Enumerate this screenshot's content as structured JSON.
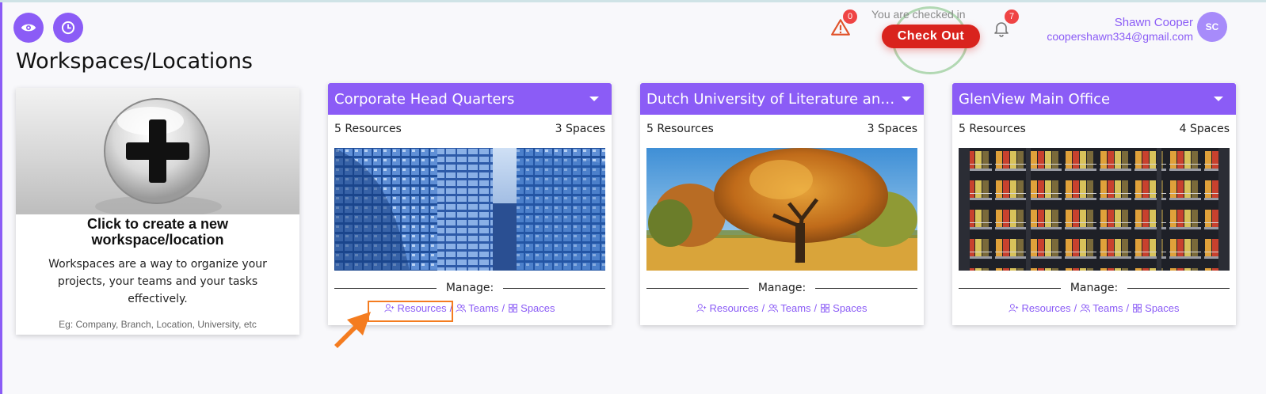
{
  "header": {
    "alerts_count": "0",
    "checked_in_text": "You are checked in",
    "checkout_label": "Check Out",
    "notifications_count": "7",
    "user_name": "Shawn Cooper",
    "user_email": "coopershawn334@gmail.com",
    "avatar_initials": "SC"
  },
  "page": {
    "title": "Workspaces/Locations"
  },
  "create_card": {
    "title": "Click to create a new workspace/location",
    "description": "Workspaces are a way to organize your projects, your teams and your tasks effectively.",
    "example": "Eg: Company, Branch, Location, University, etc"
  },
  "workspaces": [
    {
      "name": "Corporate Head Quarters",
      "resources": "5 Resources",
      "spaces": "3 Spaces"
    },
    {
      "name": "Dutch University of Literature and Arts",
      "resources": "5 Resources",
      "spaces": "3 Spaces"
    },
    {
      "name": "GlenView Main Office",
      "resources": "5 Resources",
      "spaces": "4 Spaces"
    }
  ],
  "manage": {
    "label": "Manage:",
    "resources_link": "Resources",
    "teams_link": "Teams",
    "spaces_link": "Spaces",
    "separator": "/"
  },
  "colors": {
    "accent": "#8b5cf6",
    "checkout": "#d9231d",
    "badge": "#ef4444",
    "highlight": "#f47c20"
  },
  "icons": {
    "left_buttons": [
      "eye-icon",
      "clock-icon"
    ],
    "warning": "warning-icon",
    "bell": "bell-icon",
    "create": "plus-icon",
    "card_caret": "caret-down-icon",
    "resources": "user-plus-icon",
    "teams": "users-icon",
    "spaces": "grid-icon"
  }
}
